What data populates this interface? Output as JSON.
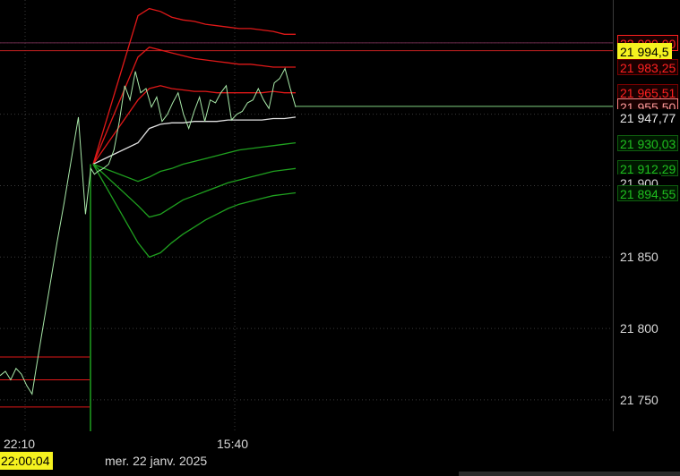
{
  "chart_data": {
    "type": "line",
    "ylim": [
      21728,
      22030
    ],
    "y_ticks": [
      "21 850",
      "21 800",
      "21 750"
    ],
    "y_tick_values": [
      21850,
      21800,
      21750
    ],
    "x_ticks": [
      "22:10",
      "15:40"
    ],
    "cursor_time": "22:00:04",
    "date_label": "mer. 22 janv. 2025",
    "price_tags": [
      {
        "text": "22 000,00",
        "value": 22000.0,
        "color": "#ff2020",
        "bg": "#1a0000",
        "border": "#ff2020"
      },
      {
        "text": "21 994,5",
        "value": 21994.5,
        "color": "#000000",
        "bg": "#f5f21f",
        "border": "#f5f21f"
      },
      {
        "text": "21 983,25",
        "value": 21983.25,
        "color": "#ff2020",
        "bg": "#1a0000",
        "border": "#7a0000"
      },
      {
        "text": "21 965,51",
        "value": 21965.51,
        "color": "#ff2020",
        "bg": "#1a0000",
        "border": "#7a0000"
      },
      {
        "text": "21 955,50",
        "value": 21955.5,
        "color": "#ff9a9a",
        "bg": "#1a0000",
        "border": "#ff8080"
      },
      {
        "text": "21 947,77",
        "value": 21947.77,
        "color": "#e8e8e8",
        "bg": "#000000",
        "border": "#000000"
      },
      {
        "text": "21 930,03",
        "value": 21930.03,
        "color": "#1fbf1f",
        "bg": "#001800",
        "border": "#0f5f0f"
      },
      {
        "text": "21 912,29",
        "value": 21912.29,
        "color": "#1fbf1f",
        "bg": "#001800",
        "border": "#0f5f0f"
      },
      {
        "text": "21 900",
        "value": 21902.0,
        "color": "#d8d8d8",
        "bg": "#000000",
        "border": "#000000"
      },
      {
        "text": "21 894,55",
        "value": 21894.55,
        "color": "#1fbf1f",
        "bg": "#001800",
        "border": "#0f5f0f"
      }
    ],
    "horizontal_lines": [
      {
        "name": "level-22000",
        "value": 22000.0,
        "color": "#6a2a4a"
      },
      {
        "name": "level-21994",
        "value": 21994.5,
        "color": "#c02020"
      },
      {
        "name": "last-price-line",
        "value": 21955.5,
        "color": "#7fd07f"
      }
    ],
    "series_time_index": [
      0,
      6,
      12,
      18,
      24,
      30,
      36,
      40,
      48,
      56,
      64,
      72,
      80,
      88,
      96,
      102,
      106,
      110,
      116,
      122,
      128,
      134,
      140,
      146,
      152,
      158,
      164,
      170,
      176,
      182,
      188,
      194,
      200,
      206,
      212,
      218,
      224,
      230,
      236,
      242,
      248,
      254,
      260,
      266,
      272,
      278,
      284,
      290,
      296,
      302,
      308,
      314,
      320,
      326,
      332
    ],
    "price_series": [
      21767,
      21770,
      21764,
      21772,
      21768,
      21760,
      21754,
      21770,
      21800,
      21830,
      21860,
      21888,
      21918,
      21948,
      21880,
      21912,
      21908,
      21910,
      21912,
      21915,
      21925,
      21945,
      21970,
      21960,
      21980,
      21965,
      21968,
      21955,
      21962,
      21945,
      21950,
      21958,
      21965,
      21950,
      21940,
      21952,
      21962,
      21945,
      21960,
      21958,
      21965,
      21970,
      21946,
      21950,
      21952,
      21958,
      21960,
      21968,
      21960,
      21954,
      21972,
      21975,
      21982,
      21968,
      21955
    ],
    "bands": [
      {
        "name": "upper-3",
        "color": "#e01818",
        "values": [
          22019,
          22024,
          22022,
          22018,
          22016,
          22015,
          22013,
          22012,
          22011,
          22010,
          22010,
          22009,
          22008,
          22006,
          22006
        ]
      },
      {
        "name": "upper-2",
        "color": "#e01818",
        "values": [
          21990,
          21997,
          21995,
          21993,
          21991,
          21989,
          21988,
          21987,
          21986,
          21985,
          21985,
          21984,
          21983,
          21983,
          21983
        ]
      },
      {
        "name": "upper-1",
        "color": "#e01818",
        "values": [
          21960,
          21968,
          21970,
          21968,
          21967,
          21966,
          21966,
          21965,
          21965,
          21965,
          21965,
          21965,
          21966,
          21965,
          21965
        ]
      },
      {
        "name": "vwap",
        "color": "#e0e0e0",
        "values": [
          21930,
          21940,
          21943,
          21944,
          21944,
          21945,
          21945,
          21945,
          21946,
          21946,
          21946,
          21946,
          21947,
          21947,
          21948
        ]
      },
      {
        "name": "lower-1",
        "color": "#1fa01f",
        "values": [
          21903,
          21906,
          21910,
          21912,
          21915,
          21917,
          21919,
          21921,
          21923,
          21925,
          21926,
          21927,
          21928,
          21929,
          21930
        ]
      },
      {
        "name": "lower-2",
        "color": "#1fa01f",
        "values": [
          21886,
          21878,
          21880,
          21885,
          21890,
          21893,
          21896,
          21899,
          21902,
          21904,
          21906,
          21908,
          21910,
          21911,
          21912
        ]
      },
      {
        "name": "lower-3",
        "color": "#1fa01f",
        "values": [
          21860,
          21850,
          21853,
          21860,
          21866,
          21871,
          21876,
          21880,
          21884,
          21887,
          21889,
          21891,
          21893,
          21894,
          21895
        ]
      }
    ],
    "prior_session_levels": [
      21780,
      21764,
      21745
    ],
    "grid": true
  }
}
